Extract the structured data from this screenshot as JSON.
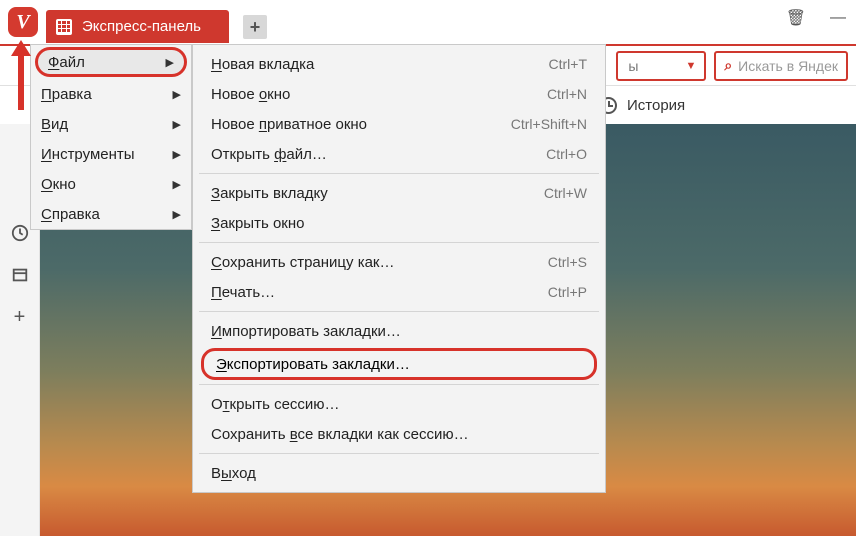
{
  "titlebar": {
    "tab_label": "Экспресс-панель",
    "new_tab_glyph": "+",
    "trash_glyph": "🗑",
    "minimize_glyph": "—"
  },
  "toolbar": {
    "select_suffix": "ы",
    "search_placeholder": "Искать в Яндек"
  },
  "linkrow": {
    "history_label": "История"
  },
  "menu": {
    "items": [
      {
        "label_pre": "",
        "hot": "Ф",
        "label_post": "айл"
      },
      {
        "label_pre": "",
        "hot": "П",
        "label_post": "равка"
      },
      {
        "label_pre": "",
        "hot": "В",
        "label_post": "ид"
      },
      {
        "label_pre": "",
        "hot": "И",
        "label_post": "нструменты"
      },
      {
        "label_pre": "",
        "hot": "О",
        "label_post": "кно"
      },
      {
        "label_pre": "",
        "hot": "С",
        "label_post": "правка"
      }
    ]
  },
  "submenu": {
    "rows": [
      {
        "pre": "",
        "hot": "Н",
        "post": "овая вкладка",
        "sc": "Ctrl+T"
      },
      {
        "pre": "Новое ",
        "hot": "о",
        "post": "кно",
        "sc": "Ctrl+N"
      },
      {
        "pre": "Новое ",
        "hot": "п",
        "post": "риватное окно",
        "sc": "Ctrl+Shift+N"
      },
      {
        "pre": "Открыть ",
        "hot": "ф",
        "post": "айл…",
        "sc": "Ctrl+O"
      },
      {
        "pre": "",
        "hot": "З",
        "post": "акрыть вкладку",
        "sc": "Ctrl+W"
      },
      {
        "pre": "",
        "hot": "З",
        "post": "акрыть окно",
        "sc": ""
      },
      {
        "pre": "",
        "hot": "С",
        "post": "охранить страницу как…",
        "sc": "Ctrl+S"
      },
      {
        "pre": "",
        "hot": "П",
        "post": "ечать…",
        "sc": "Ctrl+P"
      },
      {
        "pre": "",
        "hot": "И",
        "post": "мпортировать закладки…",
        "sc": ""
      },
      {
        "pre": "",
        "hot": "Э",
        "post": "кспортировать закладки…",
        "sc": ""
      },
      {
        "pre": "О",
        "hot": "т",
        "post": "крыть сессию…",
        "sc": ""
      },
      {
        "pre": "Сохранить ",
        "hot": "в",
        "post": "се вкладки как сессию…",
        "sc": ""
      },
      {
        "pre": "В",
        "hot": "ы",
        "post": "ход",
        "sc": ""
      }
    ]
  }
}
